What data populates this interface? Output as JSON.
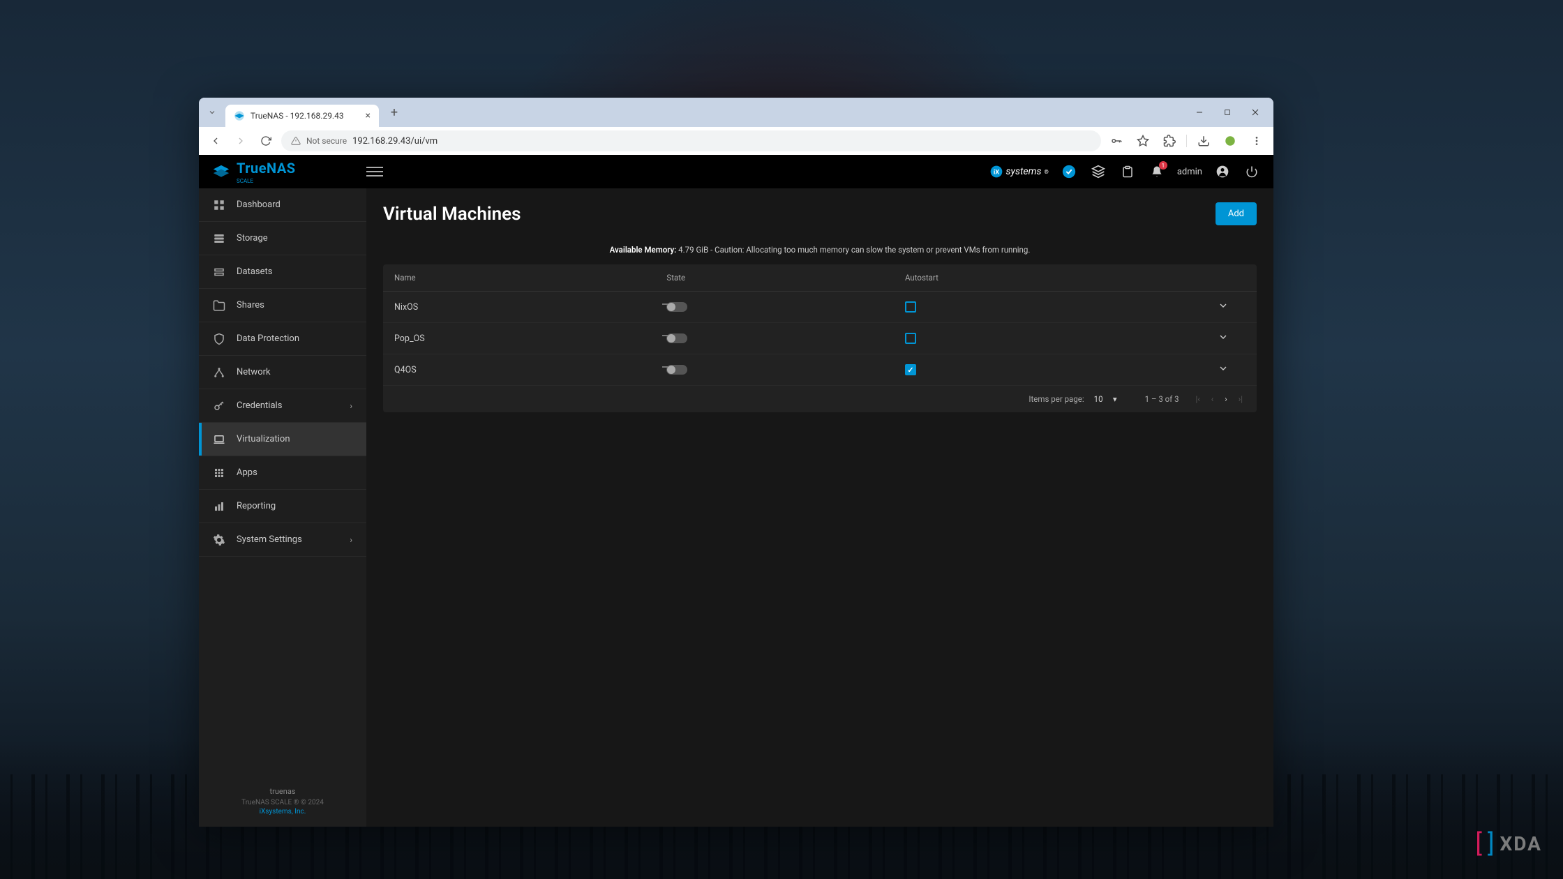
{
  "browser": {
    "tab_title": "TrueNAS - 192.168.29.43",
    "not_secure_label": "Not secure",
    "url": "192.168.29.43/ui/vm"
  },
  "topbar": {
    "product_name": "TrueNAS",
    "product_edition": "SCALE",
    "company_logo": "iX systems",
    "admin_label": "admin",
    "notification_count": "1"
  },
  "sidebar": {
    "items": [
      {
        "label": "Dashboard",
        "icon": "dashboard",
        "expandable": false
      },
      {
        "label": "Storage",
        "icon": "storage",
        "expandable": false
      },
      {
        "label": "Datasets",
        "icon": "datasets",
        "expandable": false
      },
      {
        "label": "Shares",
        "icon": "shares",
        "expandable": false
      },
      {
        "label": "Data Protection",
        "icon": "shield",
        "expandable": false
      },
      {
        "label": "Network",
        "icon": "network",
        "expandable": false
      },
      {
        "label": "Credentials",
        "icon": "key",
        "expandable": true
      },
      {
        "label": "Virtualization",
        "icon": "laptop",
        "expandable": false,
        "active": true
      },
      {
        "label": "Apps",
        "icon": "apps",
        "expandable": false
      },
      {
        "label": "Reporting",
        "icon": "chart",
        "expandable": false
      },
      {
        "label": "System Settings",
        "icon": "gear",
        "expandable": true
      }
    ],
    "footer": {
      "hostname": "truenas",
      "copyright": "TrueNAS SCALE ® © 2024",
      "company": "iXsystems, Inc."
    }
  },
  "page": {
    "title": "Virtual Machines",
    "add_button": "Add",
    "memory_label": "Available Memory:",
    "memory_value": "4.79 GiB - Caution: Allocating too much memory can slow the system or prevent VMs from running."
  },
  "table": {
    "columns": {
      "name": "Name",
      "state": "State",
      "autostart": "Autostart"
    },
    "rows": [
      {
        "name": "NixOS",
        "state_on": false,
        "autostart": false
      },
      {
        "name": "Pop_OS",
        "state_on": false,
        "autostart": false
      },
      {
        "name": "Q4OS",
        "state_on": false,
        "autostart": true
      }
    ],
    "footer": {
      "items_per_page_label": "Items per page:",
      "items_per_page_value": "10",
      "range": "1 – 3 of 3"
    }
  },
  "watermark": "XDA"
}
